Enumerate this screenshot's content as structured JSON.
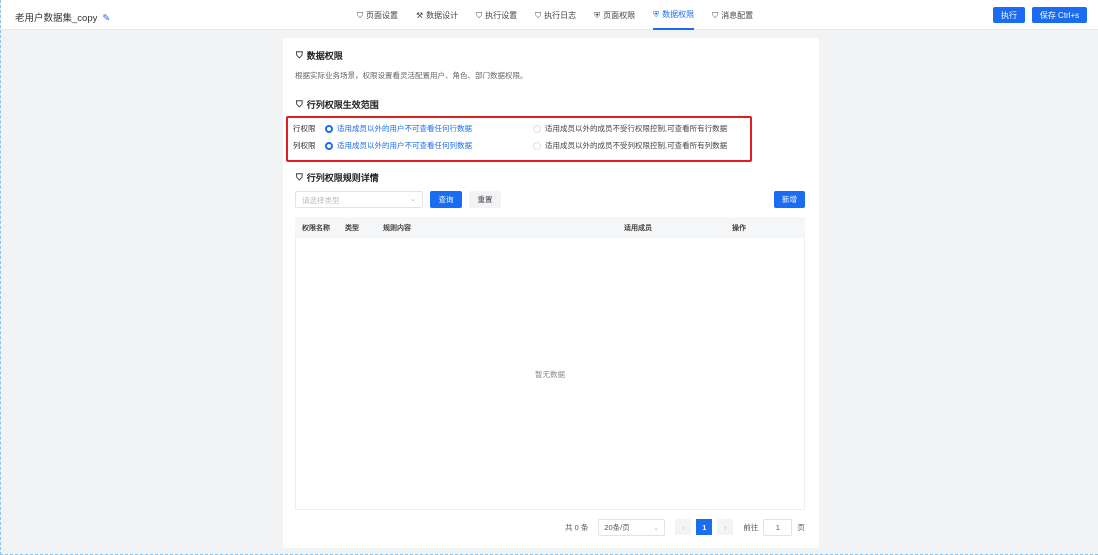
{
  "header": {
    "title": "老用户数据集_copy",
    "tabs": [
      {
        "label": "页面设置",
        "icon": "bookmark-icon"
      },
      {
        "label": "数据设计",
        "icon": "design-icon"
      },
      {
        "label": "执行设置",
        "icon": "bookmark-icon"
      },
      {
        "label": "执行日志",
        "icon": "bookmark-icon"
      },
      {
        "label": "页面权限",
        "icon": "shield-icon"
      },
      {
        "label": "数据权限",
        "icon": "shield-icon",
        "active": true
      },
      {
        "label": "消息配置",
        "icon": "bookmark-icon"
      }
    ],
    "run_label": "执行",
    "save_label": "保存 Ctrl+s"
  },
  "section1": {
    "title": "数据权限",
    "desc": "根据实际业务场景，权限设置看灵活配置用户、角色、部门数据权限。"
  },
  "section2": {
    "title": "行列权限生效范围",
    "rows": [
      {
        "label": "行权限",
        "opt1": "适用成员以外的用户不可查看任何行数据",
        "opt2": "适用成员以外的成员不受行权限控制,可查看所有行数据"
      },
      {
        "label": "列权限",
        "opt1": "适用成员以外的用户不可查看任何列数据",
        "opt2": "适用成员以外的成员不受列权限控制,可查看所有列数据"
      }
    ]
  },
  "section3": {
    "title": "行列权限规则详情",
    "select_placeholder": "请选择类型",
    "query": "查询",
    "reset": "重置",
    "add": "新增",
    "columns": [
      "权限名称",
      "类型",
      "规则内容",
      "适用成员",
      "操作"
    ],
    "empty": "暂无数据"
  },
  "pagination": {
    "total": "共 0 条",
    "page_size": "20条/页",
    "current": "1",
    "goto": "前往",
    "goto_value": "1",
    "page_unit": "页"
  }
}
